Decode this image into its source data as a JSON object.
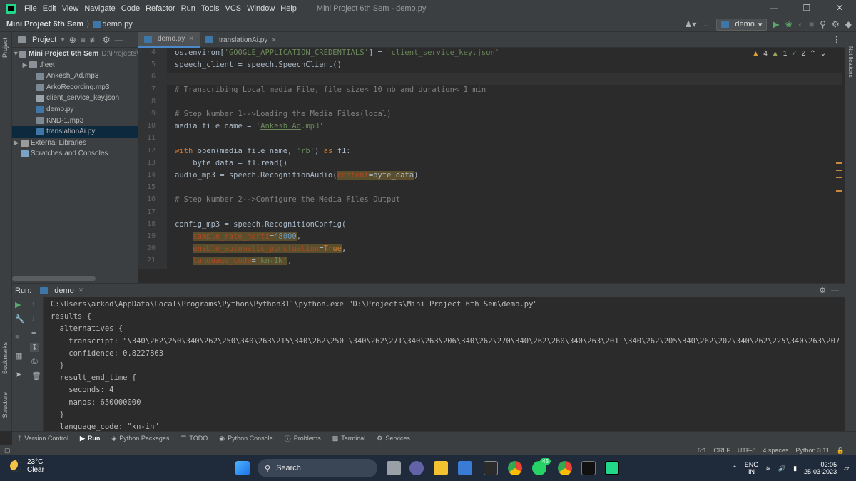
{
  "menubar": {
    "items": [
      "File",
      "Edit",
      "View",
      "Navigate",
      "Code",
      "Refactor",
      "Run",
      "Tools",
      "VCS",
      "Window",
      "Help"
    ],
    "title": "Mini Project 6th Sem - demo.py"
  },
  "navbar": {
    "project": "Mini Project 6th Sem",
    "file": "demo.py",
    "run_config": "demo"
  },
  "project_panel": {
    "header": "Project",
    "root": "Mini Project 6th Sem",
    "root_path": "D:\\Projects\\",
    "items": [
      ".fleet",
      "Ankesh_Ad.mp3",
      "ArkoRecording.mp3",
      "client_service_key.json",
      "demo.py",
      "KND-1.mp3",
      "translationAi.py"
    ],
    "external": "External Libraries",
    "scratches": "Scratches and Consoles"
  },
  "left_tool_labels": {
    "project": "Project",
    "bookmarks": "Bookmarks",
    "structure": "Structure"
  },
  "right_tool_labels": {
    "notifications": "Notifications"
  },
  "editor": {
    "tabs": [
      "demo.py",
      "translationAi.py"
    ],
    "inspections": {
      "warnings": "4",
      "weak": "1",
      "typos": "2"
    },
    "line_numbers": [
      "4",
      "5",
      "6",
      "7",
      "8",
      "9",
      "10",
      "11",
      "12",
      "13",
      "14",
      "15",
      "16",
      "17",
      "18",
      "19",
      "20",
      "21"
    ]
  },
  "run_panel": {
    "label": "Run:",
    "tab": "demo",
    "output": [
      "C:\\Users\\arkod\\AppData\\Local\\Programs\\Python\\Python311\\python.exe \"D:\\Projects\\Mini Project 6th Sem\\demo.py\"",
      "results {",
      "  alternatives {",
      "    transcript: \"\\340\\262\\250\\340\\262\\250\\340\\263\\215\\340\\262\\250 \\340\\262\\271\\340\\263\\206\\340\\262\\270\\340\\262\\260\\340\\263\\201 \\340\\262\\205\\340\\262\\202\\340\\262\\225\\340\\263\\207\\34",
      "    confidence: 0.8227863",
      "  }",
      "  result_end_time {",
      "    seconds: 4",
      "    nanos: 650000000",
      "  }",
      "  language_code: \"kn-in\""
    ]
  },
  "bottom_tabs": [
    "Version Control",
    "Run",
    "Python Packages",
    "TODO",
    "Python Console",
    "Problems",
    "Terminal",
    "Services"
  ],
  "status": {
    "pos": "6:1",
    "sep": "CRLF",
    "enc": "UTF-8",
    "indent": "4 spaces",
    "interp": "Python 3.11"
  },
  "taskbar": {
    "temp": "23°C",
    "cond": "Clear",
    "search": "Search",
    "lang1": "ENG",
    "lang2": "IN",
    "time": "02:05",
    "date": "25-03-2023",
    "badge": "45"
  }
}
